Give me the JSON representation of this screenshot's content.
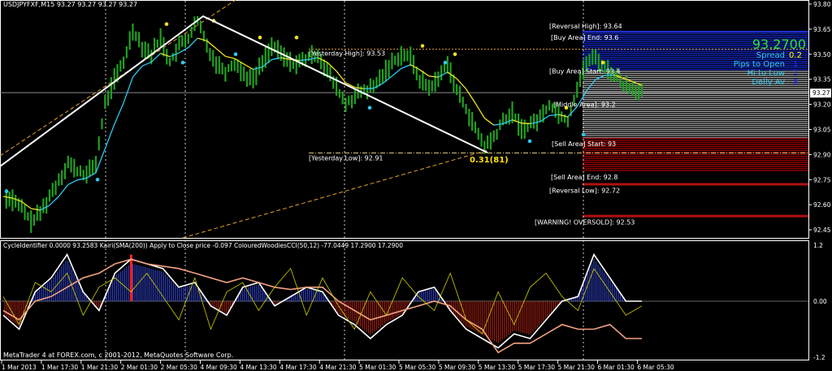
{
  "header": {
    "title": "USDJPYFXF,M15  93.27 93.27 93.27 93.27"
  },
  "indicator_header": "CycleIdentifier 0.0000 93.2583  Kairi(SMA(200)) Apply to Close price -0.097  ColouredWoodiesCCI(50,12) -77.0449 17.2900 17.2900",
  "footer": "MetaTrader 4 at FOREX.com, c 2001-2012, MetaQuotes Software Corp.",
  "current_price_label": "93.27",
  "info_panel": {
    "price": "93.2700",
    "rows": [
      {
        "label": "Spread",
        "value": "0.2",
        "value_color": "#ffff00"
      },
      {
        "label": "Pips to Open",
        "value": "1",
        "value_color": "#2030ff"
      },
      {
        "label": "Hi to Low",
        "value": "1",
        "value_color": "#2030ff"
      },
      {
        "label": "Daily Av",
        "value": "8",
        "value_color": "#2030ff"
      }
    ]
  },
  "levels": [
    {
      "text": "[Reversal High]: 93.64",
      "price": 93.64
    },
    {
      "text": "[Buy Area] End: 93.6",
      "price": 93.6
    },
    {
      "text": "[Yesterday High]: 93.53",
      "price": 93.53
    },
    {
      "text": "[Buy Area] Start: 93.4",
      "price": 93.4
    },
    {
      "text": "[Middle Area]: 93.2",
      "price": 93.2
    },
    {
      "text": "[Sell Area] Start: 93",
      "price": 93.0
    },
    {
      "text": "[Yesterday Low]: 92.91",
      "price": 92.91
    },
    {
      "text": "[Sell Area] End: 92.8",
      "price": 92.8
    },
    {
      "text": "[Reversal Low]: 92.72",
      "price": 92.72
    },
    {
      "text": "[WARNING! OVERSOLD]: 92.53",
      "price": 92.53
    }
  ],
  "zigzag_label": "0.31(81)",
  "colors": {
    "bar": "#1fa01f",
    "ma_up": "#30c8f0",
    "ma_down": "#f0e020",
    "buy_zone": "#1020a0",
    "sell_zone": "#900000",
    "trend": "#e0a030"
  },
  "chart_data": [
    {
      "type": "bar",
      "title": "USDJPYFXF,M15",
      "ylim": [
        92.4,
        93.82
      ],
      "y_ticks": [
        "93.80",
        "93.65",
        "93.50",
        "93.35",
        "93.20",
        "93.05",
        "92.90",
        "92.75",
        "92.60",
        "92.45"
      ],
      "x_ticks": [
        "1 Mar 2013",
        "1 Mar 17:30",
        "1 Mar 21:30",
        "2 Mar 01:30",
        "2 Mar 05:30",
        "4 Mar 09:30",
        "4 Mar 13:30",
        "4 Mar 17:30",
        "4 Mar 21:30",
        "5 Mar 01:30",
        "5 Mar 05:30",
        "5 Mar 09:30",
        "5 Mar 13:30",
        "5 Mar 17:30",
        "5 Mar 21:30",
        "6 Mar 01:30",
        "6 Mar 05:30"
      ],
      "closes": [
        92.65,
        92.62,
        92.58,
        92.5,
        92.55,
        92.65,
        92.75,
        92.85,
        92.8,
        92.78,
        92.85,
        93.2,
        93.35,
        93.45,
        93.65,
        93.55,
        93.5,
        93.6,
        93.45,
        93.55,
        93.6,
        93.7,
        93.55,
        93.45,
        93.4,
        93.45,
        93.38,
        93.35,
        93.45,
        93.55,
        93.5,
        93.45,
        93.45,
        93.48,
        93.5,
        93.4,
        93.3,
        93.2,
        93.25,
        93.28,
        93.3,
        93.38,
        93.45,
        93.5,
        93.48,
        93.35,
        93.3,
        93.35,
        93.45,
        93.28,
        93.18,
        93.05,
        92.95,
        93.0,
        93.1,
        93.15,
        93.05,
        93.08,
        93.12,
        93.2,
        93.15,
        93.1,
        93.3,
        93.45,
        93.48,
        93.42,
        93.38,
        93.32,
        93.3,
        93.27
      ]
    },
    {
      "type": "line",
      "title": "CycleIdentifier / Kairi / ColouredWoodiesCCI",
      "ylim": [
        -1.2,
        1.2
      ],
      "y_ticks": [
        "1.2",
        "0.00",
        "-1.2"
      ],
      "series": [
        {
          "name": "CCI",
          "color": "#ffffff",
          "values": [
            -0.3,
            -0.6,
            0.2,
            0.5,
            1.0,
            0.2,
            -0.2,
            0.6,
            0.9,
            0.8,
            0.7,
            0.3,
            0.4,
            -0.1,
            -0.3,
            0.3,
            0.4,
            -0.1,
            0.1,
            0.3,
            0.2,
            -0.3,
            -0.5,
            -0.8,
            -0.5,
            -0.3,
            0.2,
            0.3,
            -0.2,
            -0.6,
            -0.8,
            -1.0,
            -0.7,
            -0.8,
            -0.4,
            0.0,
            0.1,
            1.0,
            0.5,
            0.0,
            0.0
          ]
        },
        {
          "name": "Kairi",
          "color": "#f0a080",
          "values": [
            -0.2,
            -0.4,
            0.0,
            0.1,
            0.3,
            0.5,
            0.6,
            0.8,
            0.9,
            0.8,
            0.75,
            0.7,
            0.6,
            0.5,
            0.4,
            0.5,
            0.4,
            0.3,
            0.25,
            0.3,
            0.3,
            0.0,
            -0.2,
            -0.4,
            -0.3,
            -0.2,
            -0.1,
            0.0,
            -0.1,
            -0.4,
            -0.6,
            -1.1,
            -0.9,
            -0.9,
            -0.7,
            -0.5,
            -0.6,
            -0.6,
            -0.5,
            -0.8,
            -0.8
          ]
        },
        {
          "name": "CycleIdentifier",
          "color": "#d0d000",
          "values": [
            0.1,
            -0.5,
            0.4,
            0.2,
            0.6,
            -0.3,
            0.3,
            0.5,
            0.2,
            0.6,
            0.1,
            -0.4,
            0.5,
            -0.6,
            0.2,
            0.4,
            -0.2,
            0.3,
            0.7,
            -0.3,
            0.5,
            -0.1,
            -0.6,
            0.2,
            -0.3,
            0.5,
            0.1,
            -0.2,
            0.6,
            -0.4,
            -0.7,
            0.2,
            -0.5,
            0.3,
            0.6,
            0.1,
            -0.2,
            0.7,
            0.2,
            -0.3,
            -0.1
          ]
        }
      ]
    }
  ]
}
